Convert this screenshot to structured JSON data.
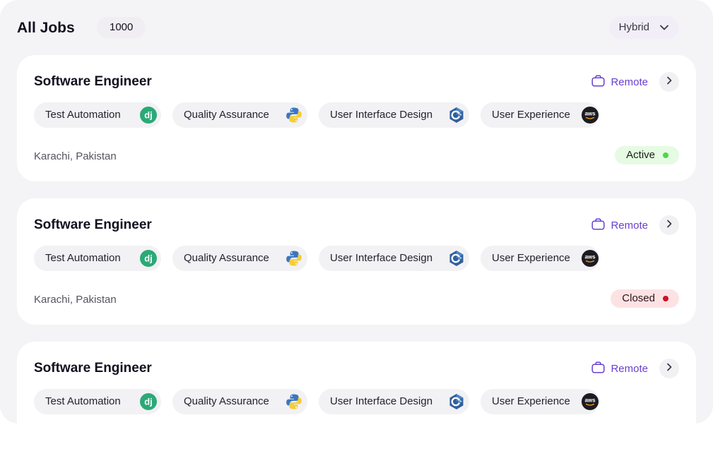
{
  "header": {
    "title": "All Jobs",
    "count": "1000",
    "filter_label": "Hybrid"
  },
  "colors": {
    "accent": "#6a3fd1",
    "active_badge_bg": "#e6fbe3",
    "active_dot": "#4fd649",
    "closed_badge_bg": "#fde2e4",
    "closed_dot": "#cc1222"
  },
  "jobs": [
    {
      "title": "Software Engineer",
      "work_type": "Remote",
      "work_type_icon": "briefcase-icon",
      "skills": [
        {
          "label": "Test Automation",
          "icon": "django-icon"
        },
        {
          "label": "Quality Assurance",
          "icon": "python-icon"
        },
        {
          "label": "User Interface Design",
          "icon": "cpp-icon"
        },
        {
          "label": "User Experience",
          "icon": "aws-icon"
        }
      ],
      "location": "Karachi, Pakistan",
      "status": "Active"
    },
    {
      "title": "Software Engineer",
      "work_type": "Remote",
      "work_type_icon": "briefcase-icon",
      "skills": [
        {
          "label": "Test Automation",
          "icon": "django-icon"
        },
        {
          "label": "Quality Assurance",
          "icon": "python-icon"
        },
        {
          "label": "User Interface Design",
          "icon": "cpp-icon"
        },
        {
          "label": "User Experience",
          "icon": "aws-icon"
        }
      ],
      "location": "Karachi, Pakistan",
      "status": "Closed"
    },
    {
      "title": "Software Engineer",
      "work_type": "Remote",
      "work_type_icon": "briefcase-icon",
      "skills": [
        {
          "label": "Test Automation",
          "icon": "django-icon"
        },
        {
          "label": "Quality Assurance",
          "icon": "python-icon"
        },
        {
          "label": "User Interface Design",
          "icon": "cpp-icon"
        },
        {
          "label": "User Experience",
          "icon": "aws-icon"
        }
      ]
    }
  ]
}
